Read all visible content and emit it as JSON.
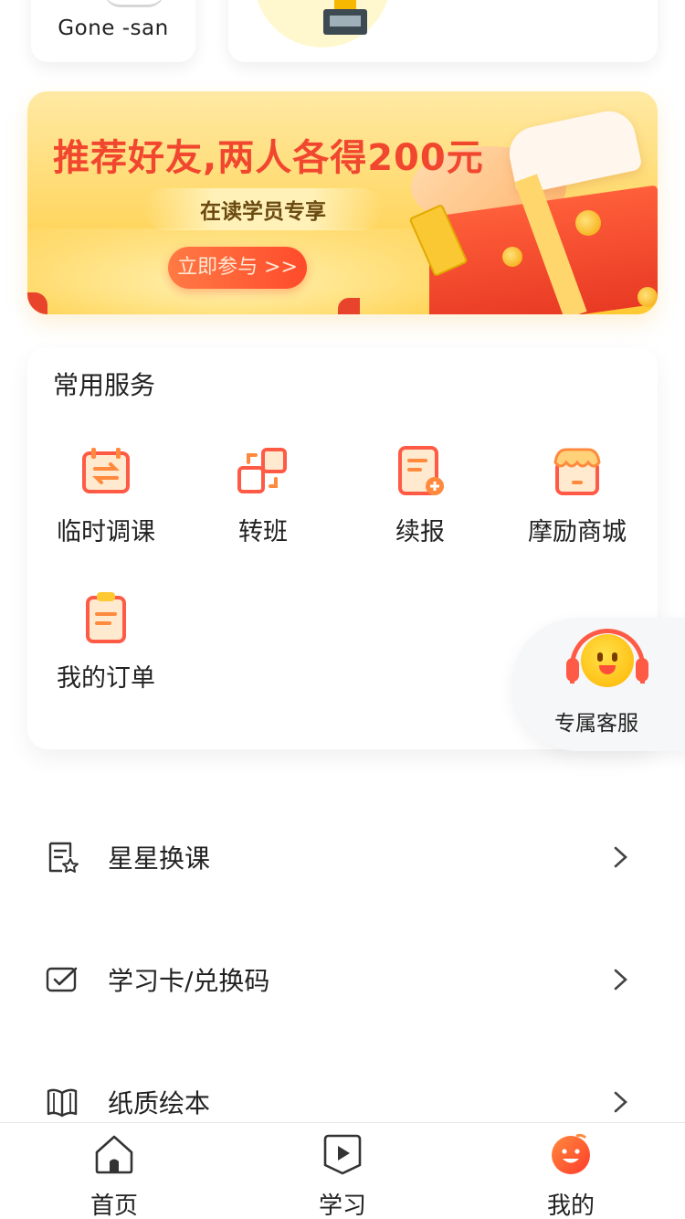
{
  "profile": {
    "username": "Gone -san"
  },
  "banner": {
    "title": "推荐好友,两人各得200元",
    "subtitle": "在读学员专享",
    "cta_label": "立即参与 >>"
  },
  "services": {
    "title": "常用服务",
    "items": [
      {
        "label": "临时调课",
        "icon": "calendar-swap-icon"
      },
      {
        "label": "转班",
        "icon": "transfer-class-icon"
      },
      {
        "label": "续报",
        "icon": "renew-document-icon"
      },
      {
        "label": "摩励商城",
        "icon": "store-icon"
      },
      {
        "label": "我的订单",
        "icon": "clipboard-icon"
      }
    ]
  },
  "support": {
    "label": "专属客服",
    "icon": "customer-service-icon"
  },
  "list": [
    {
      "label": "星星换课",
      "icon": "star-receipt-icon"
    },
    {
      "label": "学习卡/兑换码",
      "icon": "card-check-icon"
    },
    {
      "label": "纸质绘本",
      "icon": "book-icon"
    }
  ],
  "tabbar": {
    "items": [
      {
        "label": "首页",
        "icon": "home-icon"
      },
      {
        "label": "学习",
        "icon": "play-icon"
      },
      {
        "label": "我的",
        "icon": "smiley-icon"
      }
    ],
    "active_index": 2
  },
  "colors": {
    "accent_red": "#ff4b2b",
    "accent_orange": "#ff8c3a",
    "accent_yellow": "#ffc933",
    "banner_title": "#f2472f"
  }
}
